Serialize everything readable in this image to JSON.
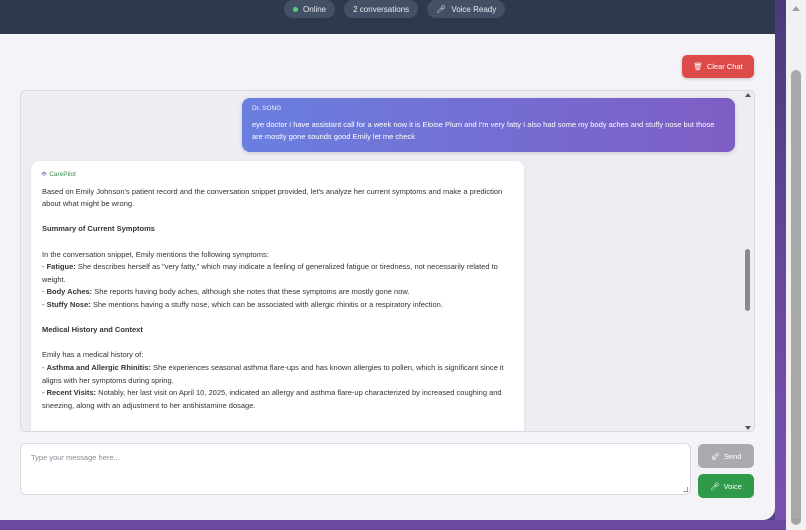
{
  "header": {
    "status_pills": [
      {
        "label": "Online",
        "icon": "status-dot-green"
      },
      {
        "label": "2 conversations",
        "icon": ""
      },
      {
        "label": "Voice Ready",
        "icon": "microphone-icon"
      }
    ]
  },
  "toolbar": {
    "clear_chat_label": "Clear Chat",
    "clear_chat_icon": "trash-icon"
  },
  "colors": {
    "accent_red": "#dd4a4a",
    "accent_green": "#2f9a4a",
    "user_bubble_start": "#6a7fe0",
    "user_bubble_end": "#7e5dc4"
  },
  "messages": [
    {
      "role": "user",
      "sender": "Dr. SONG",
      "text": "eye doctor I have assistant call for a week now it is Eloise Plum and I'm very fatty I also had some my body aches and stuffy nose but those are mostly gone sounds good Emily let me check"
    },
    {
      "role": "assistant",
      "sender": "CarePilot",
      "sender_icon": "robot-icon",
      "intro": "Based on Emily Johnson's patient record and the conversation snippet provided, let's analyze her current symptoms and make a prediction about what might be wrong.",
      "section1_heading": "Summary of Current Symptoms",
      "section1_intro": "In the conversation snippet, Emily mentions the following symptoms:",
      "section1_items": [
        {
          "term": "Fatigue:",
          "text": "She describes herself as \"very fatty,\" which may indicate a feeling of generalized fatigue or tiredness, not necessarily related to weight."
        },
        {
          "term": "Body Aches:",
          "text": "She reports having body aches, although she notes that these symptoms are mostly gone now."
        },
        {
          "term": "Stuffy Nose:",
          "text": "She mentions having a stuffy nose, which can be associated with allergic rhinitis or a respiratory infection."
        }
      ],
      "section2_heading": "Medical History and Context",
      "section2_intro": "Emily has a medical history of:",
      "section2_items": [
        {
          "term": "Asthma and Allergic Rhinitis:",
          "text": "She experiences seasonal asthma flare-ups and has known allergies to pollen, which is significant since it aligns with her symptoms during spring."
        },
        {
          "term": "Recent Visits:",
          "text": "Notably, her last visit on April 10, 2025, indicated an allergy and asthma flare-up characterized by increased coughing and sneezing, along with an adjustment to her antihistamine dosage."
        }
      ]
    }
  ],
  "composer": {
    "placeholder": "Type your message here...",
    "send_label": "Send",
    "send_icon": "send-icon",
    "voice_label": "Voice",
    "voice_icon": "microphone-icon"
  }
}
